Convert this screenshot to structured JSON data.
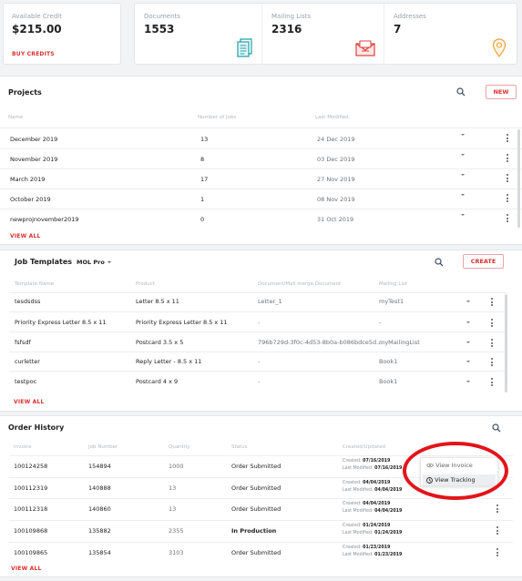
{
  "credit": {
    "label": "Available Credit",
    "value": "$215.00",
    "buy": "BUY CREDITS"
  },
  "stats": [
    {
      "label": "Documents",
      "value": "1553",
      "icon": "document-icon"
    },
    {
      "label": "Mailing Lists",
      "value": "2316",
      "icon": "envelope-icon"
    },
    {
      "label": "Addresses",
      "value": "7",
      "icon": "location-pin-icon"
    }
  ],
  "projects": {
    "title": "Projects",
    "new": "NEW",
    "columns": [
      "Name",
      "Number of Jobs",
      "Last Modified"
    ],
    "rows": [
      {
        "name": "December 2019",
        "jobs": "13",
        "modified": "24 Dec 2019"
      },
      {
        "name": "November 2019",
        "jobs": "8",
        "modified": "03 Dec 2019"
      },
      {
        "name": "March 2019",
        "jobs": "17",
        "modified": "27 Nov 2019"
      },
      {
        "name": "October 2019",
        "jobs": "1",
        "modified": "08 Nov 2019"
      },
      {
        "name": "newprojnovember2019",
        "jobs": "0",
        "modified": "31 Oct 2019"
      }
    ],
    "view_all": "VIEW ALL"
  },
  "templates": {
    "title": "Job Templates",
    "filter": "MOL Pro",
    "create": "CREATE",
    "columns": [
      "Template Name",
      "Product",
      "Document/Mail merge Document",
      "Mailing List"
    ],
    "rows": [
      {
        "name": "tesdsdss",
        "product": "Letter 8.5 x 11",
        "document": "Letter_1",
        "list": "myTest1"
      },
      {
        "name": "Priority Express Letter 8.5 x 11",
        "product": "Priority Express Letter 8.5 x 11",
        "document": "-",
        "list": "-"
      },
      {
        "name": "fsfsdf",
        "product": "Postcard 3.5 x 5",
        "document": "796b729d-3f0c-4d53-8b0a-b086bdce5d...",
        "list": "myMailingList"
      },
      {
        "name": "curletter",
        "product": "Reply Letter - 8.5 x 11",
        "document": "-",
        "list": "Book1"
      },
      {
        "name": "testpoc",
        "product": "Postcard 4 x 9",
        "document": "-",
        "list": "Book1"
      }
    ],
    "view_all": "VIEW ALL"
  },
  "orders": {
    "title": "Order History",
    "columns": [
      "Invoice",
      "Job Number",
      "Quantity",
      "Status",
      "Created/Updated"
    ],
    "created_label": "Created:",
    "modified_label": "Last Modified:",
    "rows": [
      {
        "invoice": "100124258",
        "job": "154894",
        "qty": "1000",
        "status": "Order Submitted",
        "created": "07/16/2019",
        "modified": "07/16/2019"
      },
      {
        "invoice": "100112319",
        "job": "140888",
        "qty": "13",
        "status": "Order Submitted",
        "created": "04/04/2019",
        "modified": "04/04/2019"
      },
      {
        "invoice": "100112318",
        "job": "140860",
        "qty": "13",
        "status": "Order Submitted",
        "created": "04/04/2019",
        "modified": "04/04/2019"
      },
      {
        "invoice": "100109868",
        "job": "135882",
        "qty": "2355",
        "status": "In Production",
        "created": "01/24/2019",
        "modified": "01/24/2019"
      },
      {
        "invoice": "100109865",
        "job": "135854",
        "qty": "3103",
        "status": "Order Submitted",
        "created": "01/23/2019",
        "modified": "01/23/2019"
      }
    ],
    "menu": {
      "view_invoice": "View Invoice",
      "view_tracking": "View Tracking"
    },
    "view_all": "VIEW ALL"
  },
  "colors": {
    "accent": "#d9302e",
    "annotation": "#e2141a",
    "icon_teal": "#1a9fa6",
    "icon_orange": "#f0a23a"
  }
}
